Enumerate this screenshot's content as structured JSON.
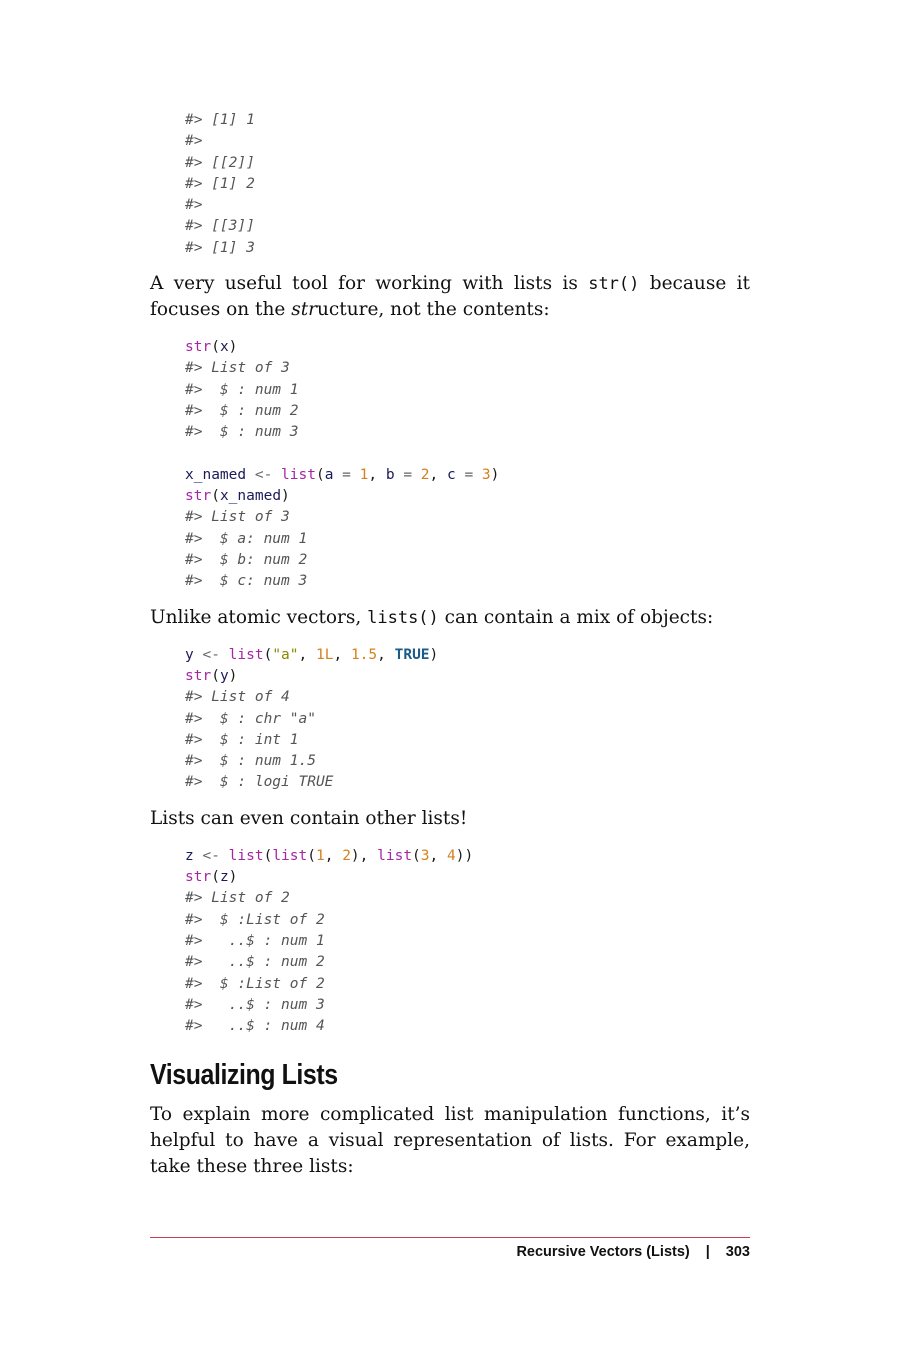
{
  "code_blocks": {
    "block0": [
      "#> [1] 1",
      "#>",
      "#> [[2]]",
      "#> [1] 2",
      "#>",
      "#> [[3]]",
      "#> [1] 3"
    ],
    "block1": [
      "str(x)",
      "#> List of 3",
      "#>  $ : num 1",
      "#>  $ : num 2",
      "#>  $ : num 3",
      "",
      "x_named <- list(a = 1, b = 2, c = 3)",
      "str(x_named)",
      "#> List of 3",
      "#>  $ a: num 1",
      "#>  $ b: num 2",
      "#>  $ c: num 3"
    ],
    "block2": [
      "y <- list(\"a\", 1L, 1.5, TRUE)",
      "str(y)",
      "#> List of 4",
      "#>  $ : chr \"a\"",
      "#>  $ : int 1",
      "#>  $ : num 1.5",
      "#>  $ : logi TRUE"
    ],
    "block3": [
      "z <- list(list(1, 2), list(3, 4))",
      "str(z)",
      "#> List of 2",
      "#>  $ :List of 2",
      "#>   ..$ : num 1",
      "#>   ..$ : num 2",
      "#>  $ :List of 2",
      "#>   ..$ : num 3",
      "#>   ..$ : num 4"
    ]
  },
  "paragraphs": {
    "p1": {
      "before_code": "A very useful tool for working with lists is ",
      "code": "str()",
      "middle": " because it focuses on the ",
      "italic": "str",
      "after": "ucture, not the contents:"
    },
    "p2": {
      "before_code": "Unlike atomic vectors, ",
      "code": "lists()",
      "after": " can contain a mix of objects:"
    },
    "p3": "Lists can even contain other lists!",
    "p4": "To explain more complicated list manipulation functions, it’s helpful to have a visual representation of lists. For example, take these three lists:"
  },
  "section_heading": "Visualizing Lists",
  "footer": {
    "chapter": "Recursive Vectors (Lists)",
    "separator": "|",
    "page_number": "303"
  }
}
